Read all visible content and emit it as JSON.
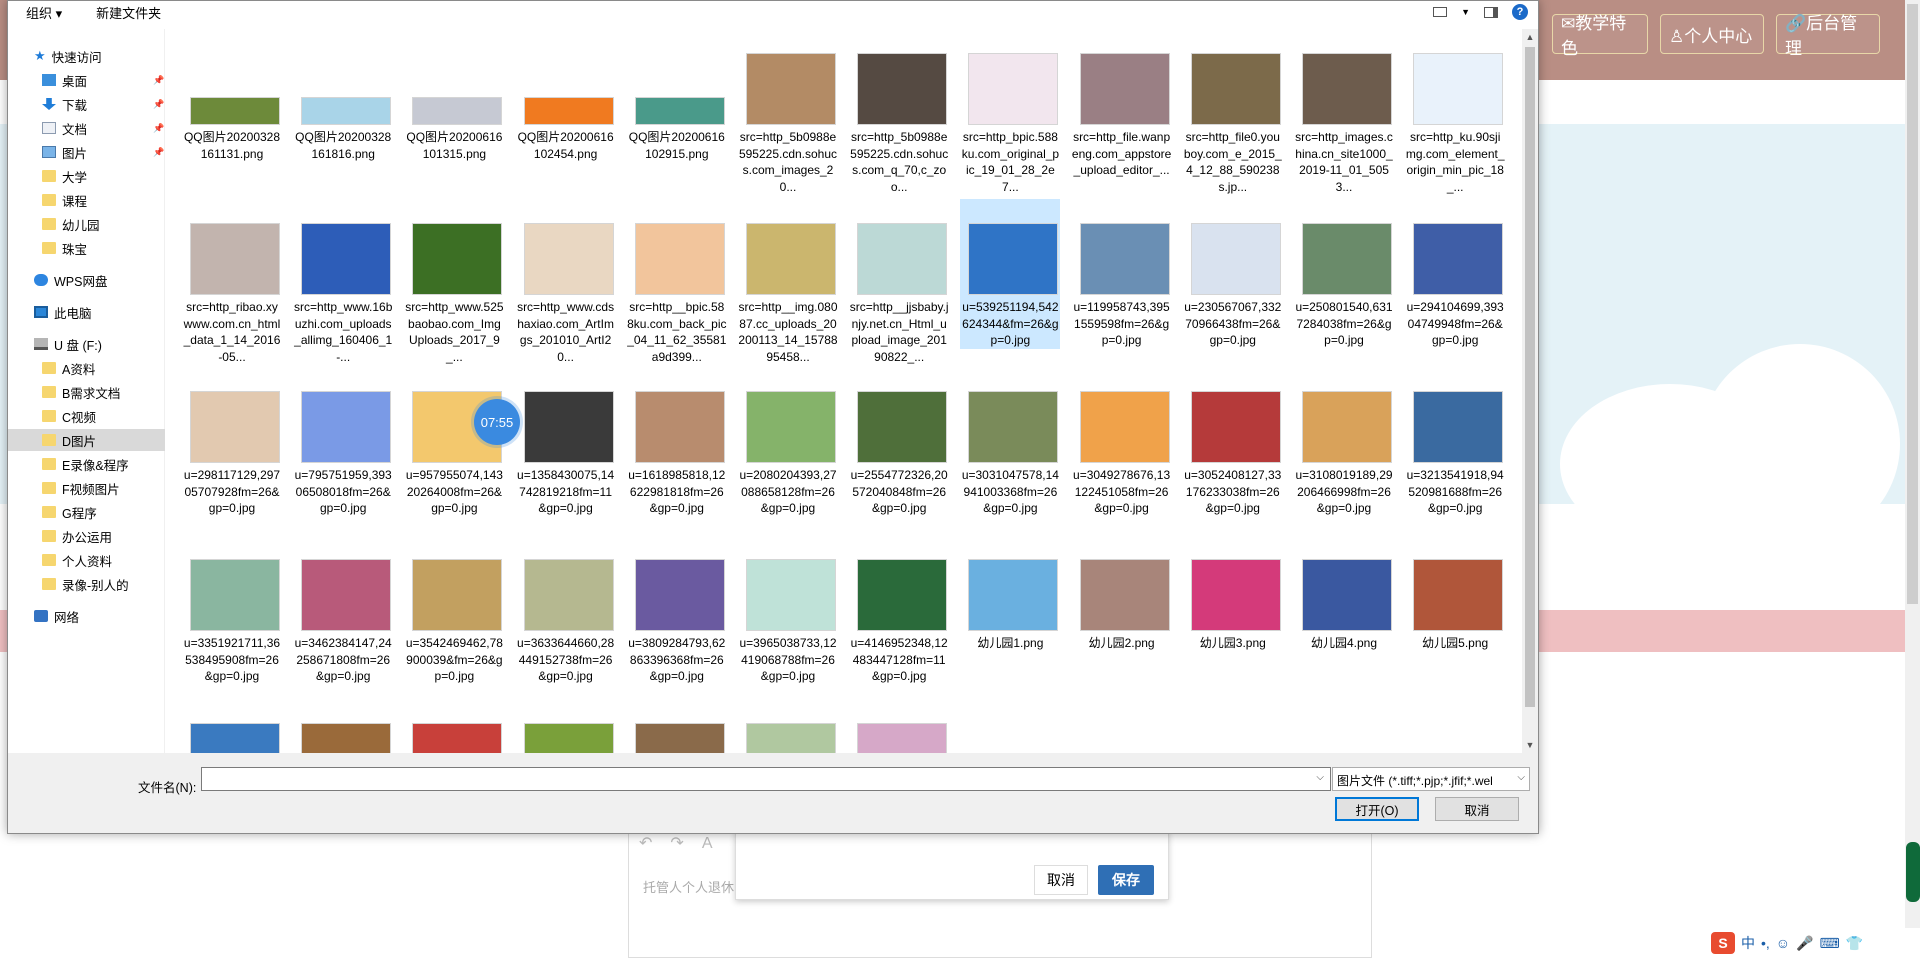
{
  "background_page": {
    "nav_buttons": [
      "✉教学特色",
      "♙个人中心",
      "🔗后台管理"
    ],
    "editor_placeholder": "托管人个人退休",
    "save_dialog": {
      "cancel": "取消",
      "save": "保存"
    },
    "ime_bar": [
      "S",
      "中",
      "•,",
      "☺",
      "🎤",
      "⌨",
      "👕"
    ]
  },
  "dialog": {
    "toolbar": {
      "organize": "组织 ▾",
      "new_folder": "新建文件夹",
      "help": "?"
    },
    "nav": [
      {
        "label": "快速访问",
        "icon": "star-icon"
      },
      {
        "label": "桌面",
        "icon": "desktop-icon",
        "pinned": true
      },
      {
        "label": "下载",
        "icon": "download-icon",
        "pinned": true
      },
      {
        "label": "文档",
        "icon": "document-icon",
        "pinned": true
      },
      {
        "label": "图片",
        "icon": "picture-icon",
        "pinned": true
      },
      {
        "label": "大学",
        "icon": "folder-icon"
      },
      {
        "label": "课程",
        "icon": "folder-icon"
      },
      {
        "label": "幼儿园",
        "icon": "folder-icon"
      },
      {
        "label": "珠宝",
        "icon": "folder-icon"
      },
      {
        "label": "WPS网盘",
        "icon": "cloud-icon"
      },
      {
        "label": "此电脑",
        "icon": "computer-icon"
      },
      {
        "label": "U 盘 (F:)",
        "icon": "drive-icon"
      },
      {
        "label": "A资料",
        "icon": "folder-icon"
      },
      {
        "label": "B需求文档",
        "icon": "folder-icon"
      },
      {
        "label": "C视频",
        "icon": "folder-icon"
      },
      {
        "label": "D图片",
        "icon": "folder-icon",
        "selected": true
      },
      {
        "label": "E录像&程序",
        "icon": "folder-icon"
      },
      {
        "label": "F视频图片",
        "icon": "folder-icon"
      },
      {
        "label": "G程序",
        "icon": "folder-icon"
      },
      {
        "label": "办公运用",
        "icon": "folder-icon"
      },
      {
        "label": "个人资料",
        "icon": "folder-icon"
      },
      {
        "label": "录像-别人的",
        "icon": "folder-icon"
      },
      {
        "label": "网络",
        "icon": "network-icon"
      }
    ],
    "files": [
      [
        "QQ图片20200328161131.png",
        "QQ图片20200328161816.png",
        "QQ图片20200616101315.png",
        "QQ图片20200616102454.png",
        "QQ图片20200616102915.png",
        "src=http_5b0988e595225.cdn.sohucs.com_images_20...",
        "src=http_5b0988e595225.cdn.sohucs.com_q_70,c_zoo...",
        "src=http_bpic.588ku.com_original_pic_19_01_28_2e7...",
        "src=http_file.wanpeng.com_appstore_upload_editor_...",
        "src=http_file0.youboy.com_e_2015_4_12_88_590238s.jp...",
        "src=http_images.china.cn_site1000_2019-11_01_5053...",
        "src=http_ku.90sjimg.com_element_origin_min_pic_18_..."
      ],
      [
        "src=http_ribao.xywww.com.cn_html_data_1_14_2016-05...",
        "src=http_www.16buzhi.com_uploads_allimg_160406_1-...",
        "src=http_www.525baobao.com_ImgUploads_2017_9_...",
        "src=http_www.cdshaxiao.com_ArtImgs_201010_ArtI20...",
        "src=http__bpic.588ku.com_back_pic_04_11_62_35581a9d399...",
        "src=http__img.08087.cc_uploads_20200113_14_1578895458...",
        "src=http__jjsbaby.jnjy.net.cn_Html_upload_image_20190822_...",
        "u=539251194,542624344&fm=26&gp=0.jpg",
        "u=119958743,3951559598fm=26&gp=0.jpg",
        "u=230567067,33270966438fm=26&gp=0.jpg",
        "u=250801540,6317284038fm=26&gp=0.jpg",
        "u=294104699,39304749948fm=26&gp=0.jpg"
      ],
      [
        "u=298117129,29705707928fm=26&gp=0.jpg",
        "u=795751959,39306508018fm=26&gp=0.jpg",
        "u=957955074,14320264008fm=26&gp=0.jpg",
        "u=1358430075,14742819218fm=11&gp=0.jpg",
        "u=1618985818,12622981818fm=26&gp=0.jpg",
        "u=2080204393,27088658128fm=26&gp=0.jpg",
        "u=2554772326,20572040848fm=26&gp=0.jpg",
        "u=3031047578,14941003368fm=26&gp=0.jpg",
        "u=3049278676,13122451058fm=26&gp=0.jpg",
        "u=3052408127,33176233038fm=26&gp=0.jpg",
        "u=3108019189,29206466998fm=26&gp=0.jpg",
        "u=3213541918,94520981688fm=26&gp=0.jpg"
      ],
      [
        "u=3351921711,36538495908fm=26&gp=0.jpg",
        "u=3462384147,24258671808fm=26&gp=0.jpg",
        "u=3542469462,78900039&fm=26&gp=0.jpg",
        "u=3633644660,28449152738fm=26&gp=0.jpg",
        "u=3809284793,62863396368fm=26&gp=0.jpg",
        "u=3965038733,12419068788fm=26&gp=0.jpg",
        "u=4146952348,12483447128fm=11&gp=0.jpg",
        "幼儿园1.png",
        "幼儿园2.png",
        "幼儿园3.png",
        "幼儿园4.png",
        "幼儿园5.png"
      ],
      [
        "",
        "",
        "",
        "",
        "",
        "",
        "",
        "",
        "",
        "",
        "",
        ""
      ]
    ],
    "thumb_colors": [
      [
        "#6d8a3a",
        "#a9d4e8",
        "#c6c9d3",
        "#f07a20",
        "#4a9a8a",
        "#b38b65",
        "#554a42",
        "#f2e6ee",
        "#9a7f84",
        "#7c6a4a",
        "#6d5c4d",
        "#e9f2fb"
      ],
      [
        "#c2b4ae",
        "#2d5db8",
        "#3c6f24",
        "#e9d7c2",
        "#f2c59c",
        "#cbb66e",
        "#bcd9d6",
        "#2f74c6",
        "#6a8fb4",
        "#d9e2ef",
        "#6a8b6a",
        "#3f5ea7"
      ],
      [
        "#e2c9b0",
        "#7a9ae6",
        "#f3c86d",
        "#3a3a3a",
        "#b88c6e",
        "#85b36a",
        "#4f6f3a",
        "#7a8b5a",
        "#f0a24a",
        "#b53a3a",
        "#d9a25a",
        "#3a6aa0"
      ],
      [
        "#8ab6a0",
        "#b85a7a",
        "#c2a060",
        "#b5b890",
        "#6a5aa0",
        "#bfe2d8",
        "#2a6a3a",
        "#6ab0e0",
        "#a8857a",
        "#d43a7a",
        "#3a58a0",
        "#b0563a"
      ],
      [
        "#3a7ac0",
        "#9a6a3a",
        "#c8403a",
        "#7aa03a",
        "#8a6a4a",
        "#b0c8a0",
        "#d6a8c8",
        "#ffffff",
        "#ffffff",
        "#ffffff",
        "#ffffff",
        "#ffffff"
      ]
    ],
    "selected_file": "u=539251194,542624344&fm=26&gp=0.jpg",
    "filename_label": "文件名(N):",
    "filename_value": "",
    "filetype": "图片文件 (*.tiff;*.pjp;*.jfif;*.wel",
    "open_button": "打开(O)",
    "cancel_button": "取消",
    "timer": "07:55"
  }
}
